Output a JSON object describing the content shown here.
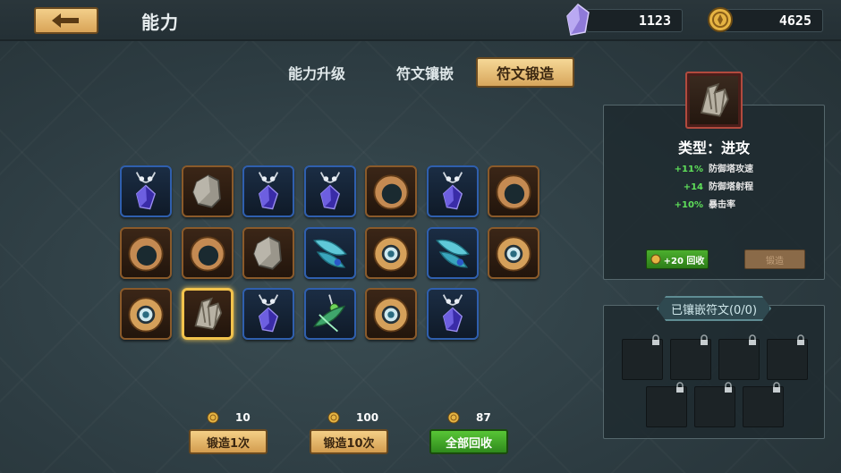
{
  "header": {
    "title": "能力",
    "crystals": "1123",
    "gold": "4625"
  },
  "tabs": [
    {
      "label": "能力升级",
      "active": false
    },
    {
      "label": "符文镶嵌",
      "active": false
    },
    {
      "label": "符文锻造",
      "active": true
    }
  ],
  "runes": [
    [
      "necklace-purple",
      "stone",
      "necklace-purple",
      "necklace-purple",
      "ring-bronze",
      "necklace-purple",
      "ring-bronze"
    ],
    [
      "ring-bronze",
      "ring-bronze",
      "stone",
      "leaf-feather",
      "ring-eye",
      "leaf-feather",
      "ring-eye"
    ],
    [
      "ring-eye",
      "armor-fragment",
      "necklace-purple",
      "leaf-amulet",
      "ring-eye",
      "necklace-purple"
    ]
  ],
  "selected_rune": {
    "row": 2,
    "col": 1
  },
  "detail": {
    "type_label": "类型：进攻",
    "stats": [
      {
        "value": "+11%",
        "name": "防御塔攻速"
      },
      {
        "value": "+14",
        "name": "防御塔射程"
      },
      {
        "value": "+10%",
        "name": "暴击率"
      }
    ],
    "recycle_label": "+20 回收",
    "forge_label": "锻造"
  },
  "inlay": {
    "title": "已镶嵌符文(0/0)",
    "locked_slots": 7
  },
  "actions": [
    {
      "cost": "10",
      "label": "锻造1次",
      "style": "gold"
    },
    {
      "cost": "100",
      "label": "锻造10次",
      "style": "gold"
    },
    {
      "cost": "87",
      "label": "全部回收",
      "style": "green"
    }
  ]
}
